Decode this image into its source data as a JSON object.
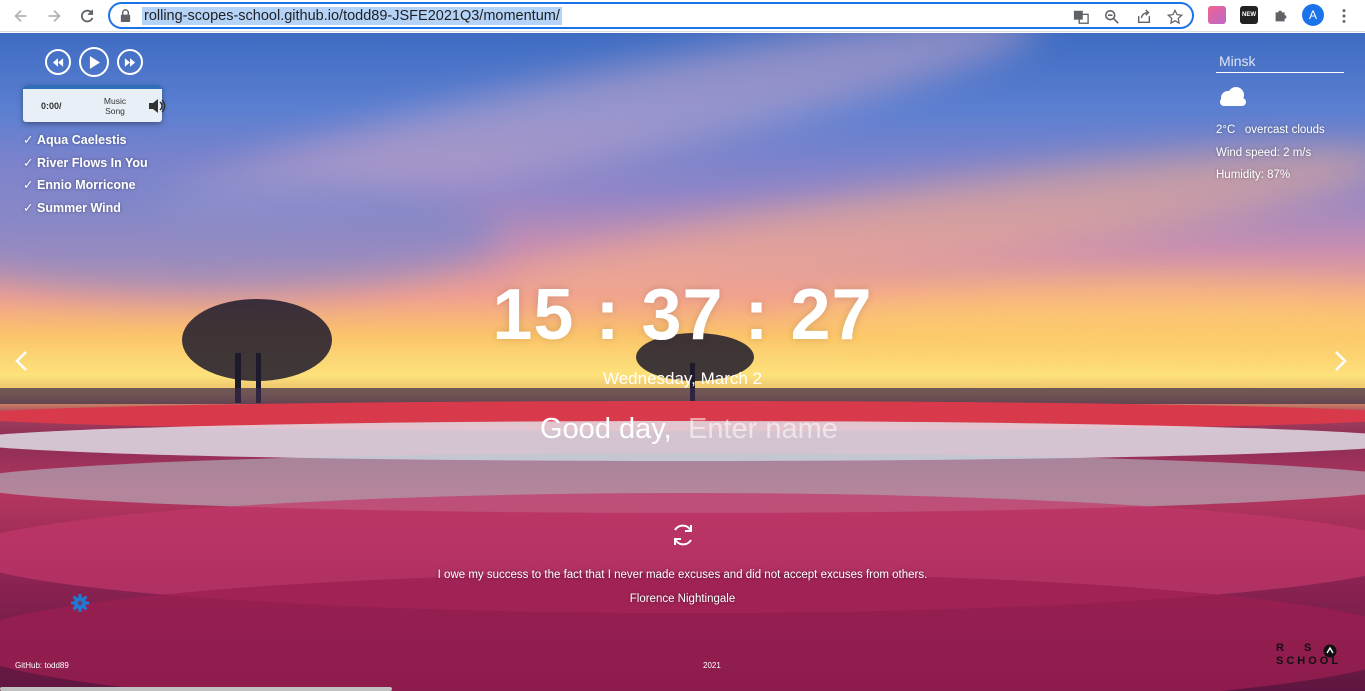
{
  "browser": {
    "url": "rolling-scopes-school.github.io/todd89-JSFE2021Q3/momentum/",
    "profile_initial": "A",
    "new_badge": "NEW"
  },
  "player": {
    "time": "0:00/",
    "song_line1": "Music",
    "song_line2": "Song",
    "playlist": [
      {
        "label": "Aqua Caelestis"
      },
      {
        "label": "River Flows In You"
      },
      {
        "label": "Ennio Morricone"
      },
      {
        "label": "Summer Wind"
      }
    ]
  },
  "weather": {
    "city": "Minsk",
    "icon": "cloud-icon",
    "temperature": "2°C",
    "description": "overcast clouds",
    "wind": "Wind speed: 2 m/s",
    "humidity": "Humidity: 87%"
  },
  "clock": {
    "time": "15 : 37 : 27",
    "date": "Wednesday, March 2"
  },
  "greeting": {
    "text": "Good day,",
    "name_placeholder": "Enter name"
  },
  "quote": {
    "text": "I owe my success to the fact that I never made excuses and did not accept excuses from others.",
    "author": "Florence Nightingale"
  },
  "footer": {
    "github": "GitHub: todd89",
    "year": "2021",
    "logo_letters": [
      "R",
      "S",
      "SCHOOL"
    ]
  },
  "colors": {
    "omnibox_focus": "#1a73e8",
    "url_selection": "#b5d3f7",
    "player_track": "#2f6fb8",
    "settings_gear": "#1e7bd6"
  }
}
